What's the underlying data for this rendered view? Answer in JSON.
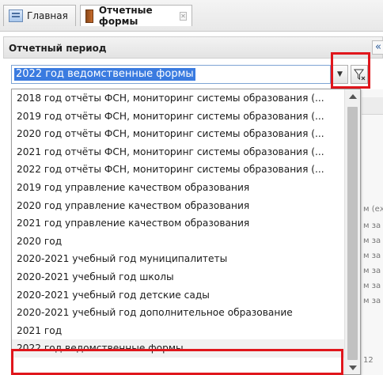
{
  "tabs": [
    {
      "label": "Главная",
      "icon": "home-icon"
    },
    {
      "label": "Отчетные формы",
      "icon": "document-icon",
      "active": true
    }
  ],
  "panel": {
    "title": "Отчетный период",
    "collapse_glyph": "«"
  },
  "combo": {
    "value": "2022 год ведомственные формы",
    "dropdown_glyph": "▼"
  },
  "dropdown": {
    "items": [
      "2018 год отчёты ФСН, мониторинг системы образования (...",
      "2019 год отчёты ФСН, мониторинг системы образования (...",
      "2020 год отчёты ФСН, мониторинг системы образования (...",
      "2021 год отчёты ФСН, мониторинг системы образования (...",
      "2022 год отчёты ФСН, мониторинг системы образования (...",
      "2019 год управление качеством образования",
      "2020 год управление качеством образования",
      "2021 год управление качеством образования",
      "2020 год",
      "2020-2021 учебный год муниципалитеты",
      "2020-2021 учебный год школы",
      "2020-2021 учебный год детские сады",
      "2020-2021 учебный год дополнительное образование",
      "2021 год",
      "2022 год ведомственные формы"
    ],
    "selected_index": 14
  },
  "background_fragments": [
    "м (еж",
    "м за",
    "м за ,",
    "м за",
    "м за",
    "м за",
    "м за",
    "12"
  ],
  "colors": {
    "highlight": "#e0161c",
    "selection": "#3a7be0"
  }
}
